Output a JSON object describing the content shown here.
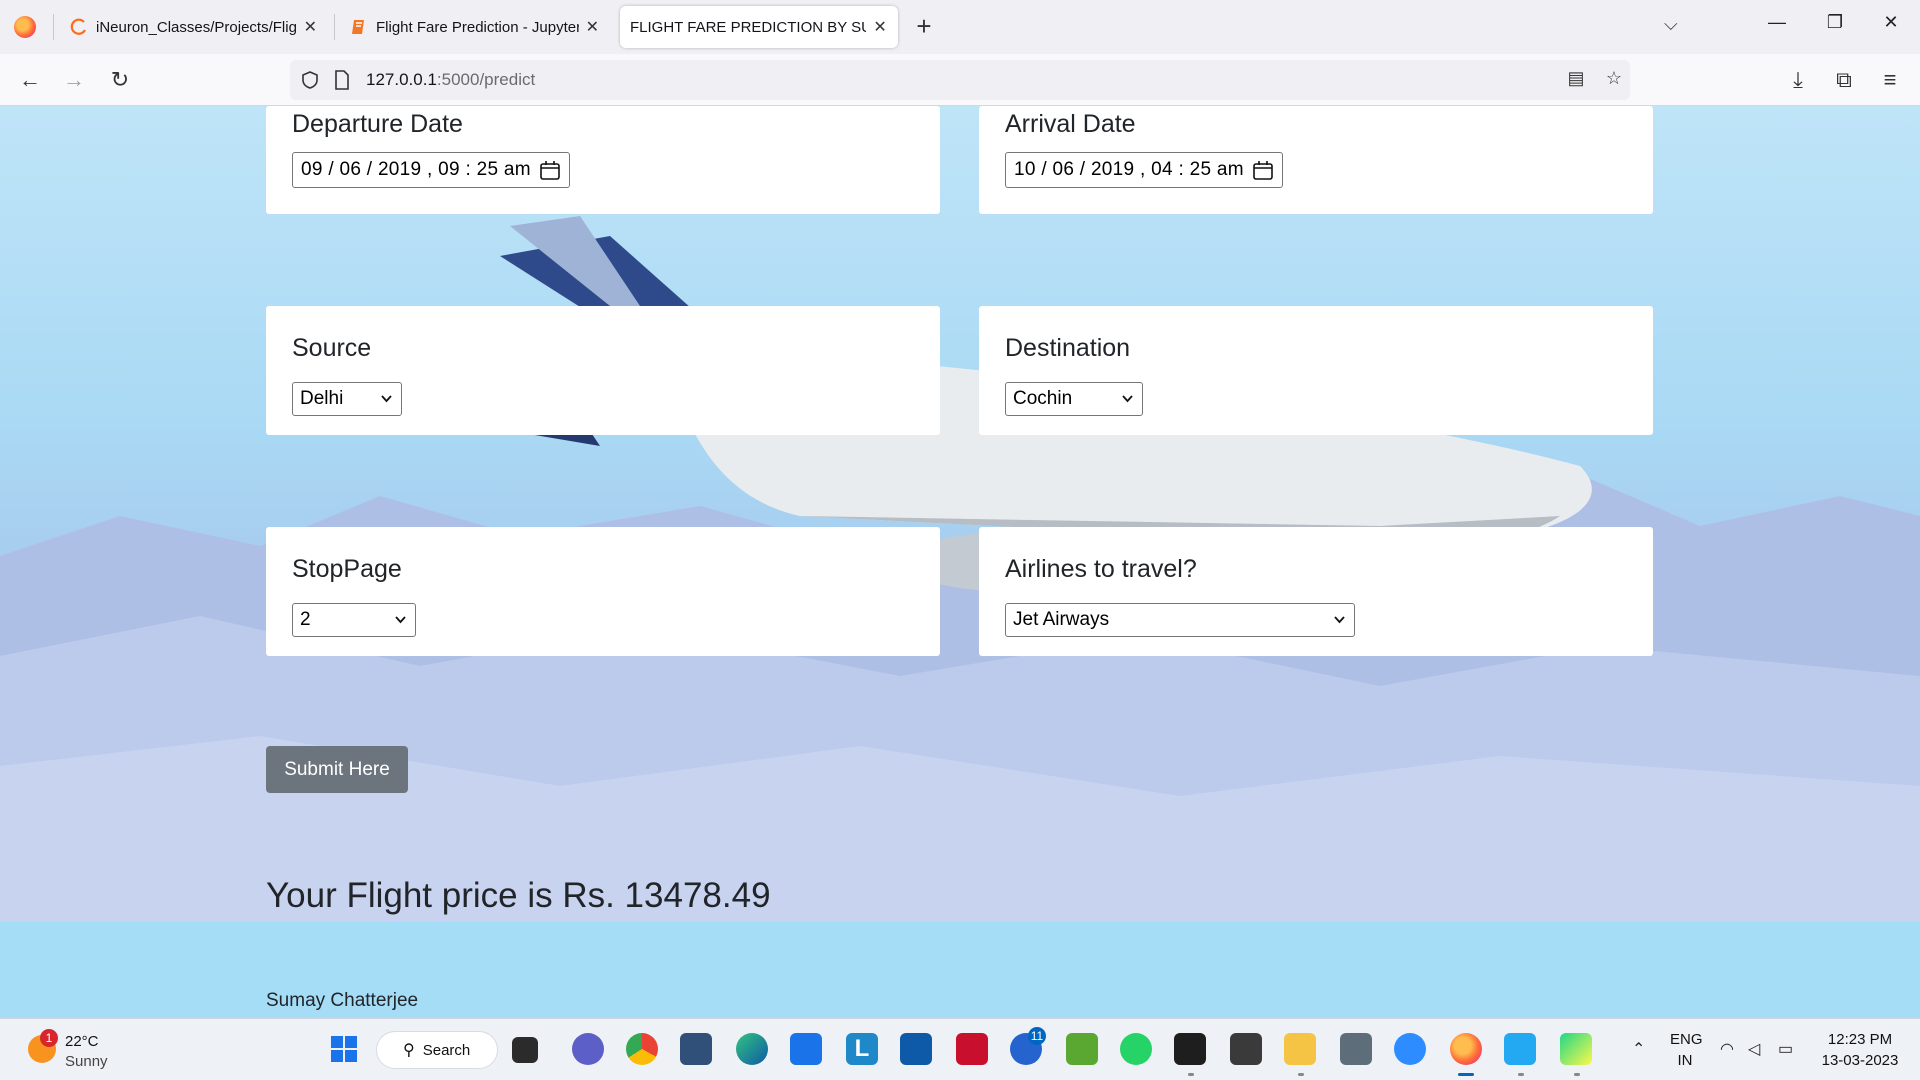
{
  "browser": {
    "tabs": [
      {
        "title": "iNeuron_Classes/Projects/Flight",
        "icon": "ineuron-icon"
      },
      {
        "title": "Flight Fare Prediction - Jupyter N",
        "icon": "jupyter-icon"
      },
      {
        "title": "FLIGHT FARE PREDICTION BY SUMA",
        "icon": "none"
      }
    ],
    "url_host": "127.0.0.1",
    "url_path": ":5000/predict"
  },
  "form": {
    "departure_label": "Departure Date",
    "departure_value": "09 / 06 / 2019 ,  09 : 25   am",
    "arrival_label": "Arrival Date",
    "arrival_value": "10 / 06 / 2019 ,  04 : 25   am",
    "source_label": "Source",
    "source_value": "Delhi",
    "destination_label": "Destination",
    "destination_value": "Cochin",
    "stoppage_label": "StopPage",
    "stoppage_value": "2",
    "airline_label": "Airlines to travel?",
    "airline_value": "Jet Airways",
    "submit_label": "Submit Here"
  },
  "result": {
    "price_text": "Your Flight price is Rs. 13478.49"
  },
  "footer": {
    "author": "Sumay Chatterjee"
  },
  "taskbar": {
    "weather_badge": "1",
    "weather_temp": "22°C",
    "weather_cond": "Sunny",
    "search_label": "Search",
    "todo_badge": "11",
    "lang_top": "ENG",
    "lang_bottom": "IN",
    "time": "12:23 PM",
    "date": "13-03-2023"
  },
  "colors": {
    "button_bg": "#6c757d",
    "taskbar_active": "#0067c0",
    "card_bg": "#ffffff"
  }
}
